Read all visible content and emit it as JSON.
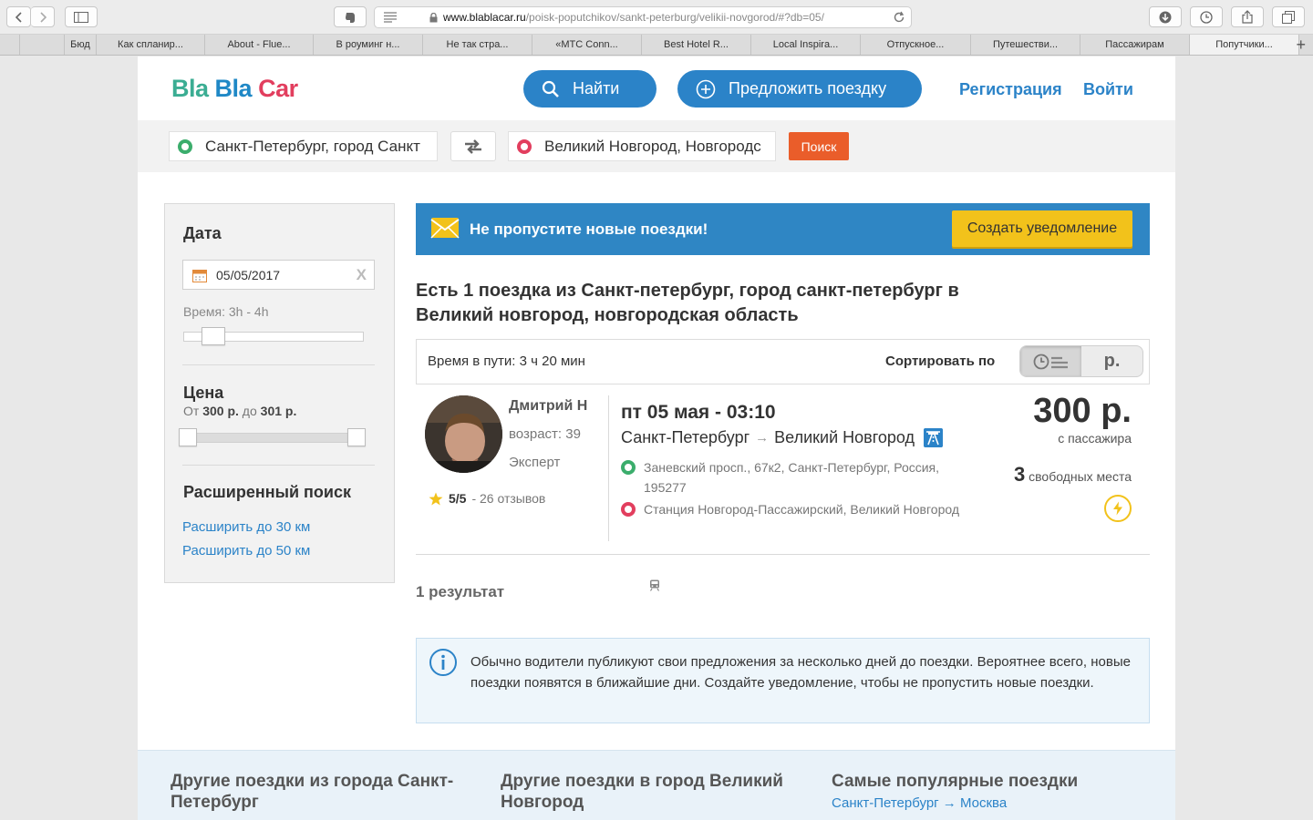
{
  "browser": {
    "url_host": "www.blablacar.ru",
    "url_path": "/poisk-poputchikov/sankt-peterburg/velikii-novgorod/#?db=05/",
    "bookmarks": [
      "",
      "",
      "Бюд",
      "Как спланир...",
      "About - Flue...",
      "В роуминг н...",
      "Не так стра...",
      "«МТС Conn...",
      "Best Hotel R...",
      "Local Inspira...",
      "Отпускное...",
      "Путешестви...",
      "Пассажирам",
      "Попутчики..."
    ]
  },
  "header": {
    "logo_bla1": "Bla",
    "logo_bla2": "Bla",
    "logo_car": "Car",
    "find_label": "Найти",
    "offer_label": "Предложить поездку",
    "register_label": "Регистрация",
    "login_label": "Войти"
  },
  "search": {
    "from": "Санкт-Петербург, город Санкт",
    "to": "Великий Новгород, Новгородс",
    "submit": "Поиск"
  },
  "filters": {
    "date_title": "Дата",
    "date_value": "05/05/2017",
    "clear": "X",
    "time_label": "Время: 3h - 4h",
    "price_title": "Цена",
    "price_prefix": "От",
    "price_min": "300 р.",
    "price_mid": "до",
    "price_max": "301 р.",
    "advanced_title": "Расширенный поиск",
    "expand_30": "Расширить до 30 км",
    "expand_50": "Расширить до 50 км"
  },
  "alert": {
    "text": "Не пропустите новые поездки!",
    "cta": "Создать уведомление"
  },
  "results": {
    "heading": "Есть 1 поездка из Санкт-петербург, город санкт-петербург в Великий новгород, новгородская область",
    "duration": "Время в пути: 3 ч 20 мин",
    "sort_label": "Сортировать по",
    "sort_price": "р.",
    "count": "1 результат"
  },
  "trip": {
    "driver": "Дмитрий Н",
    "age": "возраст: 39",
    "level": "Эксперт",
    "rating": "5/5",
    "reviews": "- 26 отзывов",
    "datetime": "пт 05 мая - 03:10",
    "route_from": "Санкт-Петербург",
    "route_arrow": "→",
    "route_to": "Великий Новгород",
    "pickup": "Заневский просп., 67к2, Санкт-Петербург, Россия, 195277",
    "dropoff": "Станция Новгород-Пассажирский, Великий Новгород",
    "price": "300 р.",
    "per": "с пассажира",
    "seats_num": "3",
    "seats_text": "свободных места"
  },
  "info": {
    "text": "Обычно водители публикуют свои предложения за несколько дней до поездки. Вероятнее всего, новые поездки появятся в ближайшие дни. Создайте уведомление, чтобы не пропустить новые поездки."
  },
  "footer": {
    "col1_title": "Другие поездки из города Санкт-Петербург",
    "col2_title": "Другие поездки в город Великий Новгород",
    "col3_title": "Самые популярные поездки",
    "col3_link": "Санкт-Петербург → Москва"
  },
  "colors": {
    "brand_blue": "#2b83c8",
    "brand_green": "#3bad93",
    "brand_red": "#e23e5e",
    "search_orange": "#ea5d2a",
    "alert_yellow": "#f2c21b"
  }
}
